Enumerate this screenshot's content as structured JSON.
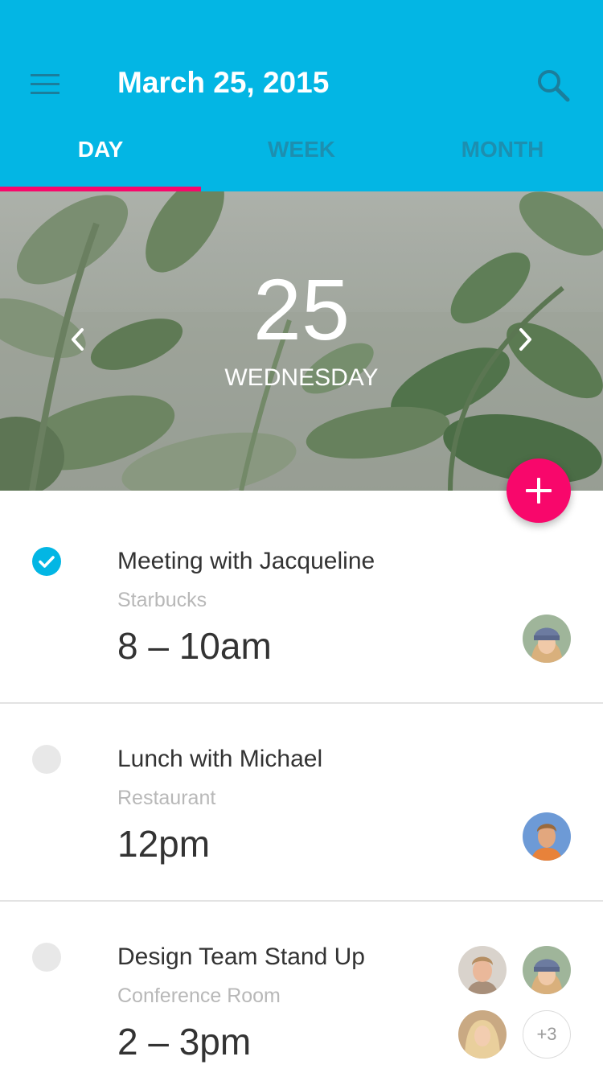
{
  "header": {
    "title": "March 25, 2015",
    "menu_icon": "hamburger-menu-icon",
    "search_icon": "search-icon",
    "background_color": "#03b6e4",
    "tabs": [
      {
        "label": "DAY",
        "active": true
      },
      {
        "label": "WEEK",
        "active": false
      },
      {
        "label": "MONTH",
        "active": false
      }
    ],
    "indicator_color": "#f8076b"
  },
  "hero": {
    "day_number": "25",
    "day_name": "WEDNESDAY",
    "prev_icon": "chevron-left-icon",
    "next_icon": "chevron-right-icon"
  },
  "fab": {
    "icon": "plus-icon",
    "color": "#f8076b"
  },
  "events": [
    {
      "title": "Meeting with Jacqueline",
      "place": "Starbucks",
      "time": "8 – 10am",
      "completed": true,
      "attendees": [
        "woman-beanie-avatar"
      ]
    },
    {
      "title": "Lunch with Michael",
      "place": "Restaurant",
      "time": "12pm",
      "completed": false,
      "attendees": [
        "man-blue-bg-avatar"
      ]
    },
    {
      "title": "Design Team Stand Up",
      "place": "Conference Room",
      "time": "2 – 3pm",
      "completed": false,
      "attendees": [
        "man-smiling-avatar",
        "woman-beanie-avatar",
        "woman-blonde-avatar"
      ],
      "more_count": "+3"
    }
  ],
  "colors": {
    "accent": "#f8076b",
    "primary": "#03b6e4",
    "text": "#333333",
    "subtext": "#b8b8b8"
  }
}
